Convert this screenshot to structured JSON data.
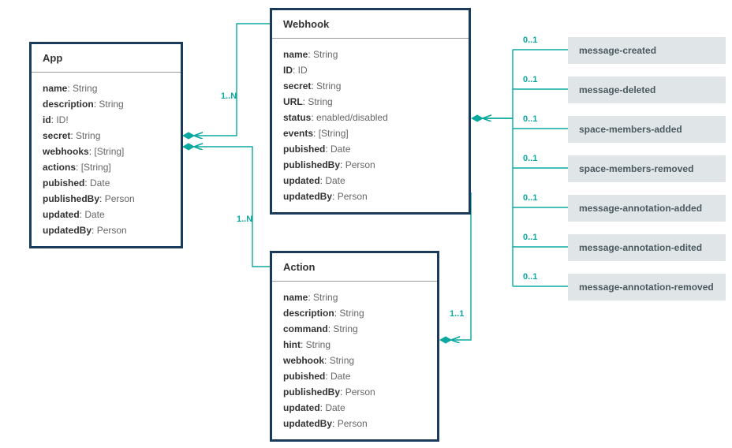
{
  "entities": {
    "app": {
      "title": "App",
      "fields": [
        {
          "name": "name",
          "type": "String"
        },
        {
          "name": "description",
          "type": "String"
        },
        {
          "name": "id",
          "type": "ID!"
        },
        {
          "name": "secret",
          "type": "String"
        },
        {
          "name": "webhooks",
          "type": "[String]"
        },
        {
          "name": "actions",
          "type": "[String]"
        },
        {
          "name": "pubished",
          "type": "Date"
        },
        {
          "name": "publishedBy",
          "type": "Person"
        },
        {
          "name": "updated",
          "type": "Date"
        },
        {
          "name": "updatedBy",
          "type": "Person"
        }
      ]
    },
    "webhook": {
      "title": "Webhook",
      "fields": [
        {
          "name": "name",
          "type": "String"
        },
        {
          "name": "ID",
          "type": "ID"
        },
        {
          "name": "secret",
          "type": "String"
        },
        {
          "name": "URL",
          "type": "String"
        },
        {
          "name": "status",
          "type": "enabled/disabled"
        },
        {
          "name": "events",
          "type": "[String]"
        },
        {
          "name": "pubished",
          "type": "Date"
        },
        {
          "name": "publishedBy",
          "type": "Person"
        },
        {
          "name": "updated",
          "type": "Date"
        },
        {
          "name": "updatedBy",
          "type": "Person"
        }
      ]
    },
    "action": {
      "title": "Action",
      "fields": [
        {
          "name": "name",
          "type": "String"
        },
        {
          "name": "description",
          "type": "String"
        },
        {
          "name": "command",
          "type": "String"
        },
        {
          "name": "hint",
          "type": "String"
        },
        {
          "name": "webhook",
          "type": "String"
        },
        {
          "name": "pubished",
          "type": "Date"
        },
        {
          "name": "publishedBy",
          "type": "Person"
        },
        {
          "name": "updated",
          "type": "Date"
        },
        {
          "name": "updatedBy",
          "type": "Person"
        }
      ]
    }
  },
  "events": [
    "message-created",
    "message-deleted",
    "space-members-added",
    "space-members-removed",
    "message-annotation-added",
    "message-annotation-edited",
    "message-annotation-removed"
  ],
  "multiplicities": {
    "m_app_webhook": "1..N",
    "m_app_action": "1..N",
    "m_action_webhook": "1..1",
    "m_event": "0..1"
  }
}
